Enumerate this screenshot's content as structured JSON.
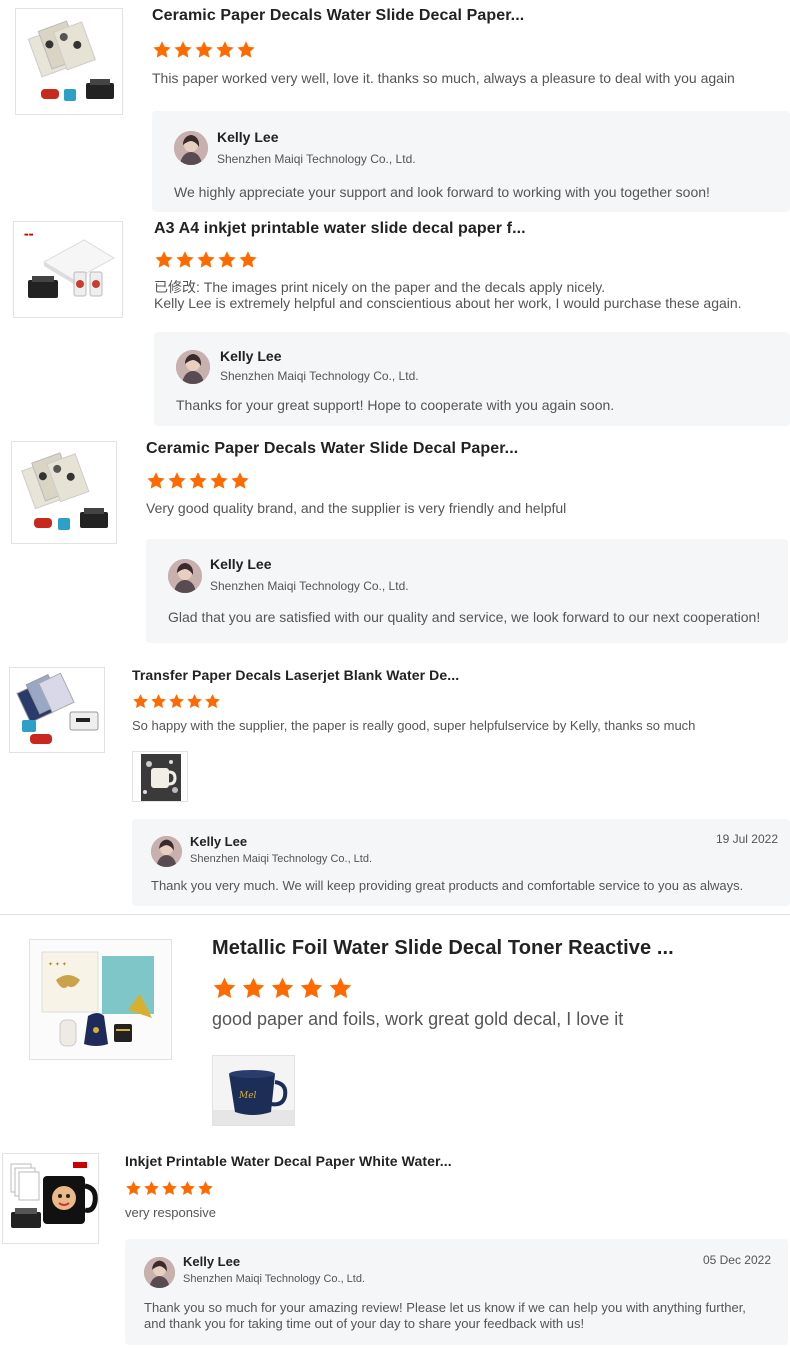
{
  "colors": {
    "star": "#ff6a00",
    "reply_bg": "#f5f6f8",
    "divider": "#e0e0e0"
  },
  "icons": {
    "rating": "star-icon",
    "avatar": "avatar-photo"
  },
  "reviews": [
    {
      "product_title": "Ceramic Paper Decals Water Slide Decal Paper...",
      "rating": 5,
      "review_text": "This paper worked very well, love it. thanks so much, always a pleasure to deal with you again",
      "reply": {
        "name": "Kelly Lee",
        "company": "Shenzhen Maiqi Technology Co., Ltd.",
        "text": "We highly appreciate your support and look forward to working with you together soon!"
      }
    },
    {
      "product_title": "A3 A4 inkjet printable water slide decal paper f...",
      "rating": 5,
      "review_text_line1": "已修改: The images print nicely on the paper and the decals apply nicely.",
      "review_text_line2": "Kelly Lee is extremely helpful and conscientious about her work, I would purchase these again.",
      "reply": {
        "name": "Kelly Lee",
        "company": "Shenzhen Maiqi Technology Co., Ltd.",
        "text": "Thanks for your great support! Hope to cooperate with you again soon."
      }
    },
    {
      "product_title": "Ceramic Paper Decals Water Slide Decal Paper...",
      "rating": 5,
      "review_text": "Very good quality brand, and the supplier is very friendly and helpful",
      "reply": {
        "name": "Kelly Lee",
        "company": "Shenzhen Maiqi Technology Co., Ltd.",
        "text": "Glad that you are satisfied with our quality and service, we look forward to our next cooperation!"
      }
    },
    {
      "product_title": "Transfer Paper Decals Laserjet Blank Water De...",
      "rating": 5,
      "review_text": "So happy with the supplier, the paper is really good, super helpfulservice by Kelly, thanks so much",
      "reply": {
        "name": "Kelly Lee",
        "company": "Shenzhen Maiqi Technology Co., Ltd.",
        "date": "19 Jul 2022",
        "text": "Thank you very much. We will keep providing great products and comfortable service to you as always."
      }
    },
    {
      "product_title": "Metallic Foil Water Slide Decal Toner Reactive ...",
      "rating": 5,
      "review_text": "good paper and foils, work great gold decal, I love it"
    },
    {
      "product_title": "Inkjet Printable Water Decal Paper White Water...",
      "rating": 5,
      "review_text": "very responsive",
      "reply": {
        "name": "Kelly Lee",
        "company": "Shenzhen Maiqi Technology Co., Ltd.",
        "date": "05 Dec 2022",
        "text_line1": "Thank you so much for your amazing review! Please let us know if we can help you with anything further,",
        "text_line2": "and thank you for taking time out of your day to share your feedback with us!"
      }
    }
  ]
}
